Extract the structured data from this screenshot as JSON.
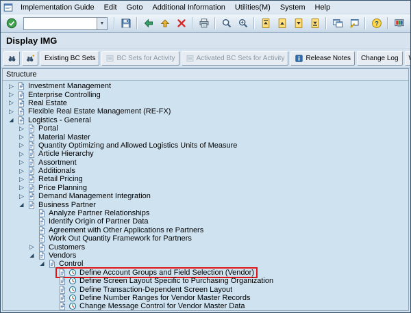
{
  "colors": {
    "highlight_red": "#e01515",
    "tree_background": "#cfe2f0"
  },
  "title": "Display IMG",
  "structure_header": "Structure",
  "menubar": {
    "window_icon": "window-menu-icon",
    "items": [
      "Implementation Guide",
      "Edit",
      "Goto",
      "Additional Information",
      "Utilities(M)",
      "System",
      "Help"
    ]
  },
  "system_toolbar": {
    "command_value": "",
    "controls": [
      {
        "type": "button",
        "name": "enter-button",
        "icon": "check-icon"
      },
      {
        "type": "command-field",
        "name": "command-field"
      },
      {
        "type": "separator"
      },
      {
        "type": "button",
        "name": "save-button",
        "icon": "save-icon"
      },
      {
        "type": "separator"
      },
      {
        "type": "button",
        "name": "back-button",
        "icon": "back-icon"
      },
      {
        "type": "button",
        "name": "exit-button",
        "icon": "exit-icon"
      },
      {
        "type": "button",
        "name": "cancel-button",
        "icon": "cancel-icon"
      },
      {
        "type": "separator"
      },
      {
        "type": "button",
        "name": "print-button",
        "icon": "print-icon"
      },
      {
        "type": "separator"
      },
      {
        "type": "button",
        "name": "find-button",
        "icon": "search-icon"
      },
      {
        "type": "button",
        "name": "find-next-button",
        "icon": "search-plus-icon"
      },
      {
        "type": "separator"
      },
      {
        "type": "button",
        "name": "first-page-button",
        "icon": "first-page-icon"
      },
      {
        "type": "button",
        "name": "previous-page-button",
        "icon": "prev-page-icon"
      },
      {
        "type": "button",
        "name": "next-page-button",
        "icon": "next-page-icon"
      },
      {
        "type": "button",
        "name": "last-page-button",
        "icon": "last-page-icon"
      },
      {
        "type": "separator"
      },
      {
        "type": "button",
        "name": "new-session-button",
        "icon": "new-session-icon"
      },
      {
        "type": "button",
        "name": "create-shortcut-button",
        "icon": "shortcut-icon"
      },
      {
        "type": "separator"
      },
      {
        "type": "button",
        "name": "help-button",
        "icon": "help-icon"
      },
      {
        "type": "separator"
      },
      {
        "type": "button",
        "name": "customize-button",
        "icon": "customize-icon"
      }
    ]
  },
  "app_toolbar": {
    "controls": [
      {
        "type": "icon-button",
        "name": "find-icon-button",
        "icon": "binoculars-icon"
      },
      {
        "type": "icon-button",
        "name": "find-next-icon-button",
        "icon": "binoculars-plus-icon"
      },
      {
        "type": "button",
        "name": "existing-bc-sets-button",
        "label": "Existing BC Sets"
      },
      {
        "type": "button",
        "name": "bc-sets-for-activity-button",
        "label": "BC Sets for Activity",
        "icon": "bc-set-icon",
        "disabled": true
      },
      {
        "type": "button",
        "name": "activated-bc-sets-for-activity-button",
        "label": "Activated BC Sets for Activity",
        "icon": "bc-set-icon",
        "disabled": true
      },
      {
        "type": "button",
        "name": "release-notes-button",
        "label": "Release Notes",
        "icon": "info-icon"
      },
      {
        "type": "button",
        "name": "change-log-button",
        "label": "Change Log"
      },
      {
        "type": "button",
        "name": "where-else-used-button",
        "label": "Where Else Used"
      }
    ]
  },
  "tree": {
    "items": [
      {
        "level": 0,
        "expander": "collapsed",
        "icons": [
          "doc-icon"
        ],
        "label": "Investment Management"
      },
      {
        "level": 0,
        "expander": "collapsed",
        "icons": [
          "doc-icon"
        ],
        "label": "Enterprise Controlling"
      },
      {
        "level": 0,
        "expander": "collapsed",
        "icons": [
          "doc-icon"
        ],
        "label": "Real Estate"
      },
      {
        "level": 0,
        "expander": "collapsed",
        "icons": [
          "doc-icon"
        ],
        "label": "Flexible Real Estate Management (RE-FX)"
      },
      {
        "level": 0,
        "expander": "expanded",
        "icons": [
          "doc-icon"
        ],
        "label": "Logistics - General"
      },
      {
        "level": 1,
        "expander": "collapsed",
        "icons": [
          "doc-icon"
        ],
        "label": "Portal"
      },
      {
        "level": 1,
        "expander": "collapsed",
        "icons": [
          "doc-icon"
        ],
        "label": "Material Master"
      },
      {
        "level": 1,
        "expander": "collapsed",
        "icons": [
          "doc-icon"
        ],
        "label": "Quantity Optimizing and Allowed Logistics Units of Measure"
      },
      {
        "level": 1,
        "expander": "collapsed",
        "icons": [
          "doc-icon"
        ],
        "label": "Article Hierarchy"
      },
      {
        "level": 1,
        "expander": "collapsed",
        "icons": [
          "doc-icon"
        ],
        "label": "Assortment"
      },
      {
        "level": 1,
        "expander": "collapsed",
        "icons": [
          "doc-icon"
        ],
        "label": "Additionals"
      },
      {
        "level": 1,
        "expander": "collapsed",
        "icons": [
          "doc-icon"
        ],
        "label": "Retail Pricing"
      },
      {
        "level": 1,
        "expander": "collapsed",
        "icons": [
          "doc-icon"
        ],
        "label": "Price Planning"
      },
      {
        "level": 1,
        "expander": "collapsed",
        "icons": [
          "doc-icon"
        ],
        "label": "Demand Management Integration"
      },
      {
        "level": 1,
        "expander": "expanded",
        "icons": [
          "doc-icon"
        ],
        "label": "Business Partner"
      },
      {
        "level": 2,
        "expander": null,
        "icons": [
          "doc-icon"
        ],
        "label": "Analyze Partner Relationships"
      },
      {
        "level": 2,
        "expander": null,
        "icons": [
          "doc-icon"
        ],
        "label": "Identify Origin of Partner Data"
      },
      {
        "level": 2,
        "expander": null,
        "icons": [
          "doc-icon"
        ],
        "label": "Agreement with Other Applications re Partners"
      },
      {
        "level": 2,
        "expander": null,
        "icons": [
          "doc-icon"
        ],
        "label": "Work Out Quantity Framework for Partners"
      },
      {
        "level": 2,
        "expander": "collapsed",
        "icons": [
          "doc-icon"
        ],
        "label": "Customers"
      },
      {
        "level": 2,
        "expander": "expanded",
        "icons": [
          "doc-icon"
        ],
        "label": "Vendors"
      },
      {
        "level": 3,
        "expander": "expanded",
        "icons": [
          "doc-icon"
        ],
        "label": "Control"
      },
      {
        "level": 4,
        "expander": null,
        "icons": [
          "doc-icon",
          "activity-icon"
        ],
        "label": "Define Account Groups and Field Selection (Vendor)",
        "highlighted": true
      },
      {
        "level": 4,
        "expander": null,
        "icons": [
          "doc-icon",
          "activity-icon"
        ],
        "label": "Define Screen Layout Specific to Purchasing Organization"
      },
      {
        "level": 4,
        "expander": null,
        "icons": [
          "doc-icon",
          "activity-icon"
        ],
        "label": "Define Transaction-Dependent Screen Layout"
      },
      {
        "level": 4,
        "expander": null,
        "icons": [
          "doc-icon",
          "activity-icon"
        ],
        "label": "Define Number Ranges for Vendor Master Records"
      },
      {
        "level": 4,
        "expander": null,
        "icons": [
          "doc-icon",
          "activity-icon"
        ],
        "label": "Change Message Control for Vendor Master Data"
      }
    ]
  }
}
